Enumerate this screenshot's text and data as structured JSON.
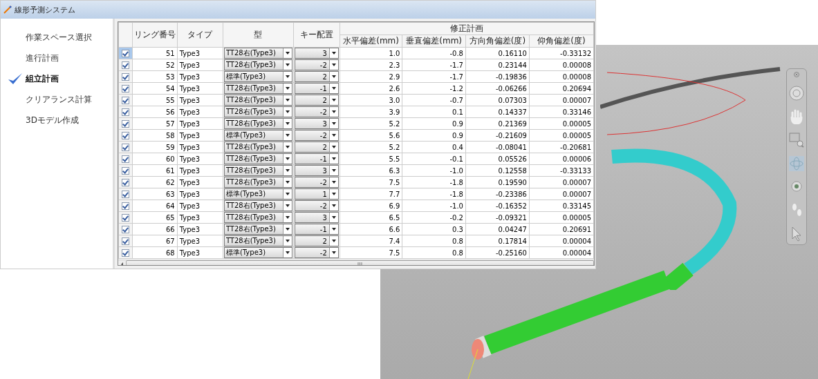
{
  "window": {
    "title": "線形予測システム"
  },
  "sidebar": {
    "items": [
      {
        "label": "作業スペース選択",
        "selected": false
      },
      {
        "label": "進行計画",
        "selected": false
      },
      {
        "label": "組立計画",
        "selected": true
      },
      {
        "label": "クリアランス計算",
        "selected": false
      },
      {
        "label": "3Dモデル作成",
        "selected": false
      }
    ]
  },
  "table": {
    "columns": [
      "リング番号",
      "タイプ",
      "型",
      "キー配置"
    ],
    "group_header": "修正計画",
    "group_columns": [
      "水平偏差(mm)",
      "垂直偏差(mm)",
      "方向角偏差(度)",
      "仰角偏差(度)"
    ],
    "rows": [
      {
        "selected": true,
        "checked": true,
        "cells": [
          "51",
          "Type3",
          "TT28右(Type3)",
          "3",
          "1.0",
          "-0.8",
          "0.16110",
          "-0.33132"
        ]
      },
      {
        "selected": false,
        "checked": true,
        "cells": [
          "52",
          "Type3",
          "TT28右(Type3)",
          "-2",
          "2.3",
          "-1.7",
          "0.23144",
          "0.00008"
        ]
      },
      {
        "selected": false,
        "checked": true,
        "cells": [
          "53",
          "Type3",
          "標準(Type3)",
          "2",
          "2.9",
          "-1.7",
          "-0.19836",
          "0.00008"
        ]
      },
      {
        "selected": false,
        "checked": true,
        "cells": [
          "54",
          "Type3",
          "TT28右(Type3)",
          "-1",
          "2.6",
          "-1.2",
          "-0.06266",
          "0.20694"
        ]
      },
      {
        "selected": false,
        "checked": true,
        "cells": [
          "55",
          "Type3",
          "TT28右(Type3)",
          "2",
          "3.0",
          "-0.7",
          "0.07303",
          "0.00007"
        ]
      },
      {
        "selected": false,
        "checked": true,
        "cells": [
          "56",
          "Type3",
          "TT28右(Type3)",
          "-2",
          "3.9",
          "0.1",
          "0.14337",
          "0.33146"
        ]
      },
      {
        "selected": false,
        "checked": true,
        "cells": [
          "57",
          "Type3",
          "TT28右(Type3)",
          "3",
          "5.2",
          "0.9",
          "0.21369",
          "0.00005"
        ]
      },
      {
        "selected": false,
        "checked": true,
        "cells": [
          "58",
          "Type3",
          "標準(Type3)",
          "-2",
          "5.6",
          "0.9",
          "-0.21609",
          "0.00005"
        ]
      },
      {
        "selected": false,
        "checked": true,
        "cells": [
          "59",
          "Type3",
          "TT28右(Type3)",
          "2",
          "5.2",
          "0.4",
          "-0.08041",
          "-0.20681"
        ]
      },
      {
        "selected": false,
        "checked": true,
        "cells": [
          "60",
          "Type3",
          "TT28右(Type3)",
          "-1",
          "5.5",
          "-0.1",
          "0.05526",
          "0.00006"
        ]
      },
      {
        "selected": false,
        "checked": true,
        "cells": [
          "61",
          "Type3",
          "TT28右(Type3)",
          "3",
          "6.3",
          "-1.0",
          "0.12558",
          "-0.33133"
        ]
      },
      {
        "selected": false,
        "checked": true,
        "cells": [
          "62",
          "Type3",
          "TT28右(Type3)",
          "-2",
          "7.5",
          "-1.8",
          "0.19590",
          "0.00007"
        ]
      },
      {
        "selected": false,
        "checked": true,
        "cells": [
          "63",
          "Type3",
          "標準(Type3)",
          "1",
          "7.7",
          "-1.8",
          "-0.23386",
          "0.00007"
        ]
      },
      {
        "selected": false,
        "checked": true,
        "cells": [
          "64",
          "Type3",
          "TT28右(Type3)",
          "-2",
          "6.9",
          "-1.0",
          "-0.16352",
          "0.33145"
        ]
      },
      {
        "selected": false,
        "checked": true,
        "cells": [
          "65",
          "Type3",
          "TT28右(Type3)",
          "3",
          "6.5",
          "-0.2",
          "-0.09321",
          "0.00005"
        ]
      },
      {
        "selected": false,
        "checked": true,
        "cells": [
          "66",
          "Type3",
          "TT28右(Type3)",
          "-1",
          "6.6",
          "0.3",
          "0.04247",
          "0.20691"
        ]
      },
      {
        "selected": false,
        "checked": true,
        "cells": [
          "67",
          "Type3",
          "TT28右(Type3)",
          "2",
          "7.4",
          "0.8",
          "0.17814",
          "0.00004"
        ]
      },
      {
        "selected": false,
        "checked": true,
        "cells": [
          "68",
          "Type3",
          "標準(Type3)",
          "-2",
          "7.5",
          "0.8",
          "-0.25160",
          "0.00004"
        ]
      }
    ]
  }
}
